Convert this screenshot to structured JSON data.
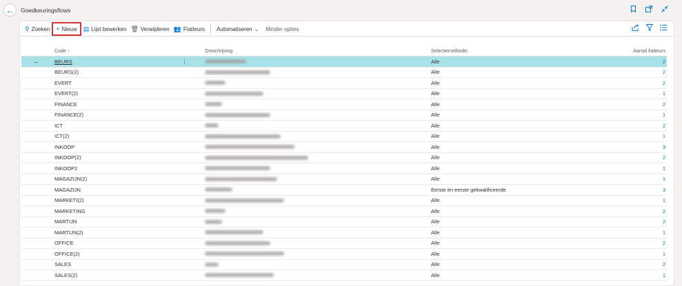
{
  "window": {
    "title": "Goedkeuringsflows"
  },
  "toolbar": {
    "search_label": "Zoeken",
    "new_label": "Nieuw",
    "edit_list_label": "Lijst bewerken",
    "delete_label": "Verwijderen",
    "approvers_label": "Fiatteurs",
    "automate_label": "Automatiseren",
    "fewer_options_label": "Minder opties"
  },
  "table": {
    "headers": {
      "code": "Code ↑",
      "description": "Omschrijving",
      "method": "Selectiemethode:",
      "count": "Aantal fiatteurs"
    },
    "rows": [
      {
        "code": "BEURS",
        "method": "Alle",
        "count": "2",
        "selected": true
      },
      {
        "code": "BEURS(2)",
        "method": "Alle",
        "count": "2"
      },
      {
        "code": "EVERT",
        "method": "Alle",
        "count": "2"
      },
      {
        "code": "EVERT(2)",
        "method": "Alle",
        "count": "1"
      },
      {
        "code": "FINANCE",
        "method": "Alle",
        "count": "2"
      },
      {
        "code": "FINANCE(2)",
        "method": "Alle",
        "count": "1"
      },
      {
        "code": "ICT",
        "method": "Alle",
        "count": "2"
      },
      {
        "code": "ICT(2)",
        "method": "Alle",
        "count": "1"
      },
      {
        "code": "INKOOP",
        "method": "Alle",
        "count": "3"
      },
      {
        "code": "INKOOP(2)",
        "method": "Alle",
        "count": "2"
      },
      {
        "code": "INKOOP2",
        "method": "Alle",
        "count": "1"
      },
      {
        "code": "MAGAZIJN(2)",
        "method": "Alle",
        "count": "1"
      },
      {
        "code": "MAGAZIJN",
        "method": "Eerste en eerste gekwalificeerde",
        "count": "3"
      },
      {
        "code": "MARKETI(2)",
        "method": "Alle",
        "count": "1"
      },
      {
        "code": "MARKETING",
        "method": "Alle",
        "count": "2"
      },
      {
        "code": "MARTIJN",
        "method": "Alle",
        "count": "2"
      },
      {
        "code": "MARTIJN(2)",
        "method": "Alle",
        "count": "1"
      },
      {
        "code": "OFFICE",
        "method": "Alle",
        "count": "2"
      },
      {
        "code": "OFFICE(2)",
        "method": "Alle",
        "count": "1"
      },
      {
        "code": "SALES",
        "method": "Alle",
        "count": "2"
      },
      {
        "code": "SALES(2)",
        "method": "Alle",
        "count": "1"
      }
    ]
  },
  "colors": {
    "accent": "#0078d4",
    "selected_row": "#a6e2e8",
    "highlight_border": "#d13438"
  }
}
